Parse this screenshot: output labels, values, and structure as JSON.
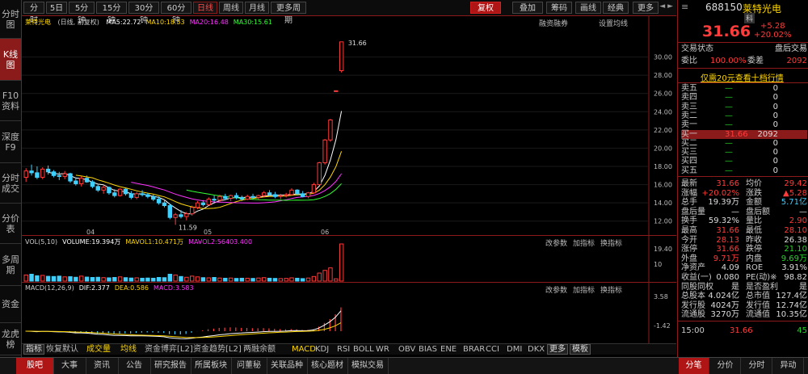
{
  "left_tabs": [
    "分时图",
    "K线图",
    "F10资料",
    "深度F9",
    "分时成交",
    "分价表",
    "多周期",
    "资金",
    "龙虎榜"
  ],
  "toolbar": {
    "periods": [
      "分时",
      "5日",
      "5分钟",
      "15分钟",
      "30分钟",
      "60分钟",
      "日线",
      "周线",
      "月线",
      "更多周期"
    ],
    "active_period": "日线",
    "tools": [
      "复权",
      "叠加",
      "筹码",
      "画线",
      "经典",
      "更多"
    ]
  },
  "main_chart": {
    "stock_label": "莱特光电",
    "mode": "(日线, 前复权)",
    "ma": [
      {
        "label": "MA",
        "value": "MA5:22.72",
        "color": "#ffffff"
      },
      {
        "label": "MA10",
        "value": "MA10:18.53",
        "color": "#ffd700"
      },
      {
        "label": "MA20",
        "value": "MA20:16.48",
        "color": "#ff33ff"
      },
      {
        "label": "MA30",
        "value": "MA30:15.61",
        "color": "#33ff33"
      }
    ],
    "right_links": [
      "融资融券",
      "设置均线"
    ],
    "y_ticks": [
      "30.00",
      "28.00",
      "26.00",
      "24.00",
      "22.00",
      "20.00",
      "18.00",
      "16.00",
      "14.00",
      "12.00"
    ],
    "high_label": "31.66",
    "low_label": "11.59"
  },
  "chart_data": {
    "type": "candlestick",
    "title": "莱特光电",
    "ylim": [
      11,
      32
    ],
    "x_labels": [
      "04",
      "05",
      "06"
    ],
    "candles": [
      [
        16.8,
        17.8,
        16.3,
        17.5
      ],
      [
        17.5,
        18.2,
        17.0,
        17.3
      ],
      [
        17.3,
        18.0,
        16.6,
        16.8
      ],
      [
        16.8,
        17.9,
        16.6,
        17.7
      ],
      [
        17.7,
        18.1,
        17.1,
        17.4
      ],
      [
        17.4,
        17.6,
        16.8,
        17.0
      ],
      [
        17.0,
        17.4,
        16.5,
        16.9
      ],
      [
        16.9,
        17.5,
        16.6,
        17.2
      ],
      [
        17.2,
        17.3,
        16.2,
        16.4
      ],
      [
        16.4,
        16.8,
        15.9,
        16.1
      ],
      [
        16.1,
        16.9,
        15.8,
        16.7
      ],
      [
        16.7,
        17.0,
        16.2,
        16.3
      ],
      [
        16.3,
        16.5,
        15.6,
        15.8
      ],
      [
        15.8,
        16.1,
        15.2,
        15.4
      ],
      [
        15.4,
        15.9,
        15.0,
        15.7
      ],
      [
        15.7,
        15.8,
        14.9,
        15.1
      ],
      [
        15.1,
        15.5,
        14.6,
        14.8
      ],
      [
        14.8,
        15.6,
        14.7,
        15.5
      ],
      [
        15.5,
        15.6,
        14.8,
        15.0
      ],
      [
        15.0,
        15.3,
        14.4,
        14.6
      ],
      [
        14.6,
        15.2,
        14.4,
        15.0
      ],
      [
        15.0,
        15.4,
        14.7,
        14.9
      ],
      [
        14.9,
        15.1,
        14.5,
        14.7
      ],
      [
        14.7,
        14.9,
        14.2,
        14.4
      ],
      [
        14.4,
        14.7,
        13.8,
        14.0
      ],
      [
        14.0,
        14.4,
        13.5,
        13.7
      ],
      [
        13.7,
        13.9,
        12.2,
        12.4
      ],
      [
        12.4,
        12.9,
        11.59,
        12.7
      ],
      [
        12.7,
        13.2,
        12.3,
        12.5
      ],
      [
        12.5,
        13.0,
        12.1,
        12.8
      ],
      [
        12.8,
        13.7,
        12.6,
        13.5
      ],
      [
        13.5,
        14.2,
        13.3,
        14.0
      ],
      [
        14.0,
        14.3,
        13.6,
        13.8
      ],
      [
        13.8,
        14.6,
        13.7,
        14.4
      ],
      [
        14.4,
        14.8,
        14.1,
        14.3
      ],
      [
        14.3,
        14.9,
        14.1,
        14.7
      ],
      [
        14.7,
        15.0,
        14.3,
        14.5
      ],
      [
        14.5,
        14.9,
        14.2,
        14.8
      ],
      [
        14.8,
        15.1,
        14.4,
        14.6
      ],
      [
        14.6,
        14.8,
        14.2,
        14.4
      ],
      [
        14.4,
        14.9,
        14.3,
        14.7
      ],
      [
        14.7,
        15.0,
        14.4,
        14.6
      ],
      [
        14.6,
        14.9,
        14.3,
        14.8
      ],
      [
        14.8,
        15.3,
        14.6,
        15.1
      ],
      [
        15.1,
        15.4,
        14.7,
        14.9
      ],
      [
        14.9,
        15.2,
        14.5,
        14.7
      ],
      [
        14.7,
        15.0,
        14.4,
        14.8
      ],
      [
        14.8,
        15.1,
        14.6,
        14.9
      ],
      [
        14.9,
        15.6,
        14.8,
        15.4
      ],
      [
        15.4,
        15.5,
        14.8,
        15.0
      ],
      [
        15.0,
        15.3,
        14.6,
        14.7
      ],
      [
        14.7,
        15.2,
        14.5,
        15.1
      ],
      [
        15.1,
        16.2,
        15.0,
        16.0
      ],
      [
        16.0,
        18.5,
        15.9,
        18.4
      ],
      [
        18.4,
        21.0,
        18.2,
        20.9
      ],
      [
        20.9,
        23.2,
        20.7,
        23.1
      ],
      [
        26.3,
        26.3,
        26.3,
        26.3
      ],
      [
        28.5,
        31.66,
        28.3,
        31.66
      ]
    ],
    "series": [
      {
        "name": "MA5",
        "color": "#ffffff"
      },
      {
        "name": "MA10",
        "color": "#ffd700"
      },
      {
        "name": "MA20",
        "color": "#ff33ff"
      },
      {
        "name": "MA30",
        "color": "#33ff33"
      }
    ],
    "volume": [
      3.2,
      3.6,
      2.8,
      3.0,
      2.5,
      2.4,
      2.6,
      2.2,
      2.3,
      2.0,
      2.6,
      2.1,
      1.9,
      2.0,
      1.8,
      1.7,
      1.9,
      2.2,
      1.8,
      1.6,
      1.7,
      1.5,
      1.6,
      1.5,
      1.9,
      1.8,
      3.6,
      3.2,
      2.4,
      2.0,
      2.6,
      2.2,
      1.8,
      1.7,
      1.9,
      1.6,
      1.5,
      1.6,
      1.4,
      1.5,
      1.5,
      1.4,
      1.6,
      1.8,
      1.5,
      1.4,
      1.3,
      1.4,
      1.7,
      1.5,
      1.3,
      1.6,
      2.4,
      4.2,
      5.6,
      6.9,
      1.2,
      19.394
    ],
    "volume_ticks": [
      "19.40",
      "10"
    ],
    "macd_ticks": [
      "3.58",
      "-1.42"
    ]
  },
  "volume_panel": {
    "legend": [
      {
        "text": "VOL(5,10)",
        "color": "#cccccc"
      },
      {
        "text": "VOLUME:19.394万",
        "color": "#ffffff"
      },
      {
        "text": "MAVOL1:10.471万",
        "color": "#ffd700"
      },
      {
        "text": "MAVOL2:56403.400",
        "color": "#ff33ff"
      }
    ],
    "buttons": [
      "改参数",
      "加指标",
      "换指标"
    ]
  },
  "macd_panel": {
    "legend": [
      {
        "text": "MACD(12,26,9)",
        "color": "#cccccc"
      },
      {
        "text": "DIF:2.377",
        "color": "#ffffff"
      },
      {
        "text": "DEA:0.586",
        "color": "#ffd700"
      },
      {
        "text": "MACD:3.583",
        "color": "#ff33ff"
      }
    ],
    "buttons": [
      "改参数",
      "加指标",
      "换指标"
    ]
  },
  "indicator_tabs": [
    "指标",
    "恢复默认",
    "成交量",
    "均线",
    "资金博弈[L2]",
    "资金趋势[L2]",
    "两融余额",
    "MACD",
    "KDJ",
    "RSI",
    "BOLL",
    "WR",
    "OBV",
    "BIAS",
    "ENE",
    "BRAR",
    "CCI",
    "DMI",
    "DKX",
    "更多",
    "模板"
  ],
  "bottom_tabs": [
    "股吧",
    "大事",
    "资讯",
    "公告",
    "研究报告",
    "所属板块",
    "问董秘",
    "关联品种",
    "核心题材",
    "模拟交易"
  ],
  "right_panel": {
    "code": "688150",
    "name": "莱特光电",
    "tag": "科",
    "price": "31.66",
    "change": "+5.28",
    "change_pct": "+20.02%",
    "trade_status_label": "交易状态",
    "trade_status": "盘后交易",
    "weibi_label": "委比",
    "weibi": "100.00%",
    "weicha_label": "委差",
    "weicha": "2092",
    "promo": "仅需20元查看十档行情",
    "sell_rows": [
      {
        "label": "卖五",
        "price": "—",
        "vol": "0"
      },
      {
        "label": "卖四",
        "price": "—",
        "vol": "0"
      },
      {
        "label": "卖三",
        "price": "—",
        "vol": "0"
      },
      {
        "label": "卖二",
        "price": "—",
        "vol": "0"
      },
      {
        "label": "卖一",
        "price": "—",
        "vol": "0"
      }
    ],
    "buy_rows": [
      {
        "label": "买一",
        "price": "31.66",
        "vol": "2092"
      },
      {
        "label": "买二",
        "price": "—",
        "vol": "0"
      },
      {
        "label": "买三",
        "price": "—",
        "vol": "0"
      },
      {
        "label": "买四",
        "price": "—",
        "vol": "0"
      },
      {
        "label": "买五",
        "price": "—",
        "vol": "0"
      }
    ],
    "stats": [
      [
        {
          "l": "最新",
          "v": "31.66",
          "c": "red"
        },
        {
          "l": "均价",
          "v": "29.42",
          "c": "red"
        }
      ],
      [
        {
          "l": "涨幅",
          "v": "+20.02%",
          "c": "red"
        },
        {
          "l": "涨跌",
          "v": "▲5.28",
          "c": "red"
        }
      ],
      [
        {
          "l": "总手",
          "v": "19.39万",
          "c": "white"
        },
        {
          "l": "金额",
          "v": "5.71亿",
          "c": "cyan"
        }
      ],
      [
        {
          "l": "盘后量",
          "v": "—",
          "c": "white"
        },
        {
          "l": "盘后额",
          "v": "—",
          "c": "white"
        }
      ],
      [
        {
          "l": "换手",
          "v": "59.32%",
          "c": "white"
        },
        {
          "l": "量比",
          "v": "2.90",
          "c": "red"
        }
      ],
      [
        {
          "l": "最高",
          "v": "31.66",
          "c": "red"
        },
        {
          "l": "最低",
          "v": "28.10",
          "c": "red"
        }
      ],
      [
        {
          "l": "今开",
          "v": "28.13",
          "c": "red"
        },
        {
          "l": "昨收",
          "v": "26.38",
          "c": "white"
        }
      ],
      [
        {
          "l": "涨停",
          "v": "31.66",
          "c": "red"
        },
        {
          "l": "跌停",
          "v": "21.10",
          "c": "green"
        }
      ],
      [
        {
          "l": "外盘",
          "v": "9.71万",
          "c": "red"
        },
        {
          "l": "内盘",
          "v": "9.69万",
          "c": "green"
        }
      ],
      [
        {
          "l": "净资产",
          "v": "4.09",
          "c": "white"
        },
        {
          "l": "ROE",
          "v": "3.91%",
          "c": "white"
        }
      ],
      [
        {
          "l": "收益(一)",
          "v": "0.080",
          "c": "white"
        },
        {
          "l": "PE(动)※",
          "v": "98.82",
          "c": "white"
        }
      ],
      [
        {
          "l": "同股同权",
          "v": "是",
          "c": "white"
        },
        {
          "l": "是否盈利",
          "v": "是",
          "c": "white"
        }
      ],
      [
        {
          "l": "总股本",
          "v": "4.024亿",
          "c": "white"
        },
        {
          "l": "总市值",
          "v": "127.4亿",
          "c": "white"
        }
      ],
      [
        {
          "l": "发行股",
          "v": "4024万",
          "c": "white"
        },
        {
          "l": "发行值",
          "v": "12.74亿",
          "c": "white"
        }
      ],
      [
        {
          "l": "流通股",
          "v": "3270万",
          "c": "white"
        },
        {
          "l": "流通值",
          "v": "10.35亿",
          "c": "white"
        }
      ]
    ],
    "tick_time": "15:00",
    "tick_price": "31.66",
    "tick_vol": "45",
    "bottom_tabs": [
      "分笔",
      "分价",
      "分时",
      "异动"
    ]
  },
  "colors": {
    "up": "#ff3b3b",
    "down": "#3fd0ff",
    "accent": "#8b1a1a"
  }
}
